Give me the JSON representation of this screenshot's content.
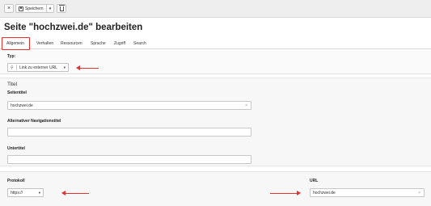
{
  "toolbar": {
    "close_glyph": "×",
    "save_label": "Speichern",
    "caret_glyph": "▾"
  },
  "page_title": "Seite \"hochzwei.de\" bearbeiten",
  "tabs": [
    {
      "label": "Allgemein",
      "active": true
    },
    {
      "label": "Verhalten",
      "active": false
    },
    {
      "label": "Ressourcen",
      "active": false
    },
    {
      "label": "Sprache",
      "active": false
    },
    {
      "label": "Zugriff",
      "active": false
    },
    {
      "label": "Search",
      "active": false
    }
  ],
  "typ": {
    "label": "Typ:",
    "value": "Link zu externer URL",
    "icon": "link-icon"
  },
  "titel_section": {
    "heading": "Titel",
    "seitentitel_label": "Seitentitel",
    "seitentitel_value": "hochzwei.de",
    "nav_label": "Alternativer Navigationstitel",
    "nav_value": "",
    "untertitel_label": "Untertitel",
    "untertitel_value": ""
  },
  "protokoll": {
    "label": "Protokoll",
    "value": "https://"
  },
  "url": {
    "label": "URL",
    "value": "hochzwei.de"
  },
  "colors": {
    "highlight": "#e5312f",
    "toolbar_bg": "#eeeeee",
    "section_bg": "#f7f7f7"
  }
}
